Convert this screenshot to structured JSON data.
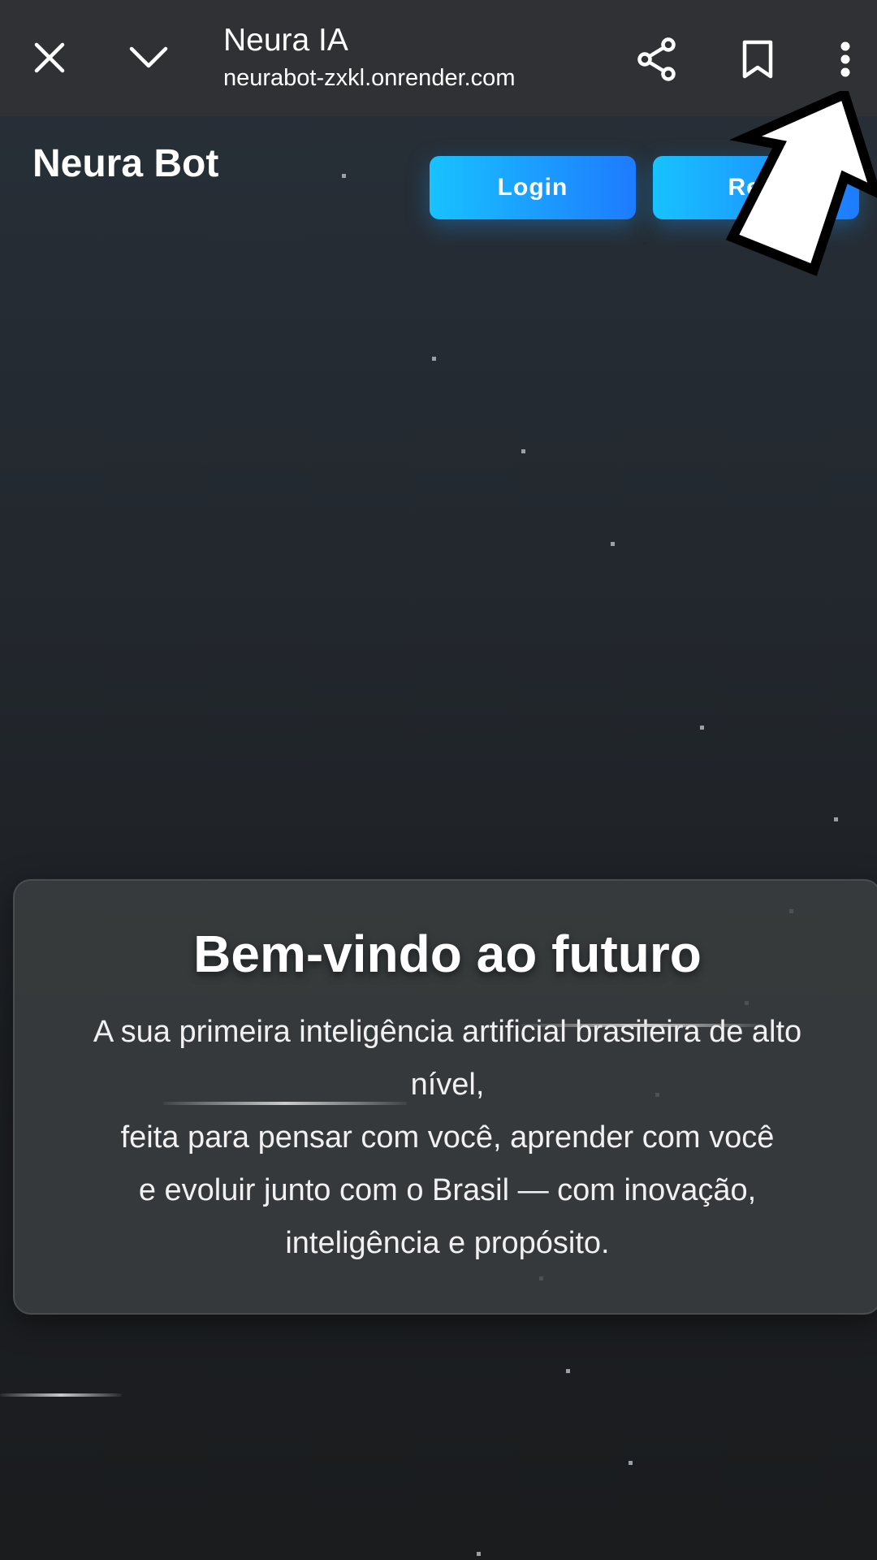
{
  "browser": {
    "title": "Neura IA",
    "url": "neurabot-zxkl.onrender.com",
    "icons": {
      "close": "close-icon",
      "minimize": "chevron-down-icon",
      "share": "share-icon",
      "bookmark": "bookmark-icon",
      "more": "more-vert-icon"
    }
  },
  "site": {
    "brand": "Neura Bot",
    "nav": {
      "login_label": "Login",
      "register_label": "Regi"
    },
    "hero": {
      "title": "Bem-vindo ao futuro",
      "lines": [
        "A sua primeira inteligência artificial brasileira de alto",
        "nível,",
        "feita para pensar com você, aprender com você",
        "e evoluir junto com o Brasil — com inovação,",
        "inteligência e propósito."
      ]
    }
  },
  "colors": {
    "toolbar": "#303134",
    "button_gradient_start": "#18c2ff",
    "button_gradient_end": "#1e7bff",
    "card_bg": "#3c3f41"
  }
}
